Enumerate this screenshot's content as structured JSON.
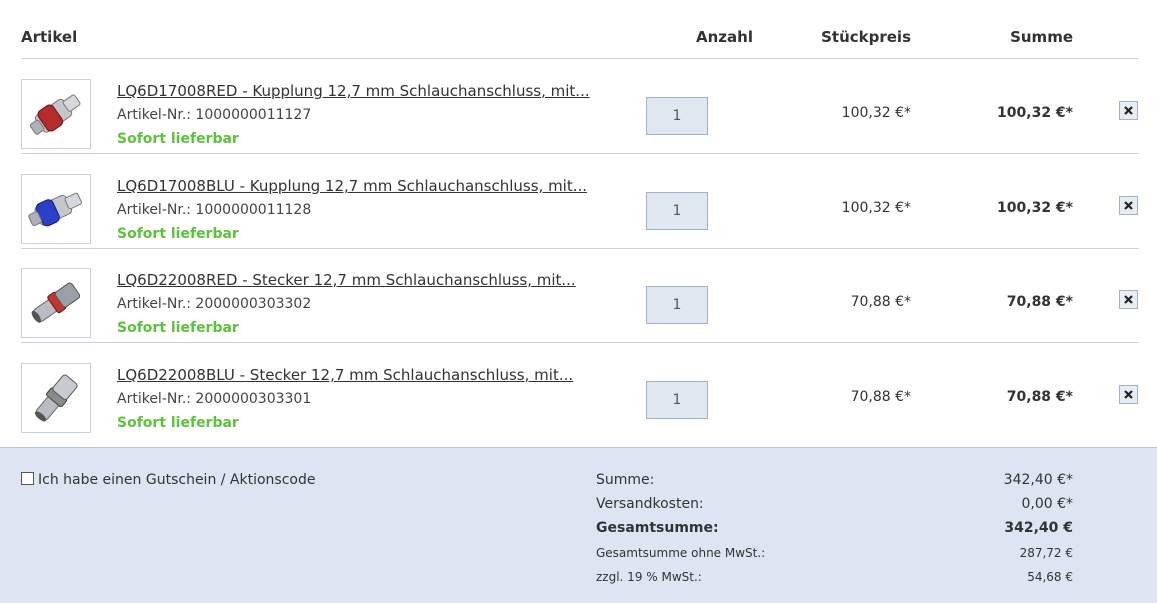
{
  "header": {
    "artikel": "Artikel",
    "anzahl": "Anzahl",
    "stueckpreis": "Stückpreis",
    "summe": "Summe"
  },
  "items": [
    {
      "title": "LQ6D17008RED - Kupplung 12,7 mm Schlauchanschluss, mit...",
      "artnr": "Artikel-Nr.: 1000000011127",
      "stock": "Sofort lieferbar",
      "qty": "1",
      "unit_price": "100,32 €*",
      "sum": "100,32 €*",
      "thumb_icon": "red-coupling-icon",
      "accent": "#b52a2a"
    },
    {
      "title": "LQ6D17008BLU - Kupplung 12,7 mm Schlauchanschluss, mit...",
      "artnr": "Artikel-Nr.: 1000000011128",
      "stock": "Sofort lieferbar",
      "qty": "1",
      "unit_price": "100,32 €*",
      "sum": "100,32 €*",
      "thumb_icon": "blue-coupling-icon",
      "accent": "#2b3fc9"
    },
    {
      "title": "LQ6D22008RED - Stecker 12,7 mm Schlauchanschluss, mit...",
      "artnr": "Artikel-Nr.: 2000000303302",
      "stock": "Sofort lieferbar",
      "qty": "1",
      "unit_price": "70,88 €*",
      "sum": "70,88 €*",
      "thumb_icon": "red-plug-icon",
      "accent": "#c0392b"
    },
    {
      "title": "LQ6D22008BLU - Stecker 12,7 mm Schlauchanschluss, mit...",
      "artnr": "Artikel-Nr.: 2000000303301",
      "stock": "Sofort lieferbar",
      "qty": "1",
      "unit_price": "70,88 €*",
      "sum": "70,88 €*",
      "thumb_icon": "blue-plug-icon",
      "accent": "#8a8a8a"
    }
  ],
  "remove_icon": "close-icon",
  "voucher": {
    "label": "Ich habe einen Gutschein / Aktionscode"
  },
  "totals": {
    "summe_label": "Summe:",
    "summe_value": "342,40 €*",
    "versand_label": "Versandkosten:",
    "versand_value": "0,00 €*",
    "gesamt_label": "Gesamtsumme:",
    "gesamt_value": "342,40 €",
    "netto_label": "Gesamtsumme ohne MwSt.:",
    "netto_value": "287,72 €",
    "mwst_label": "zzgl. 19 % MwSt.:",
    "mwst_value": "54,68 €"
  },
  "colors": {
    "stock_green": "#5cc33c",
    "footer_bg": "#dce5f1",
    "qty_bg": "#dfe7f1"
  }
}
